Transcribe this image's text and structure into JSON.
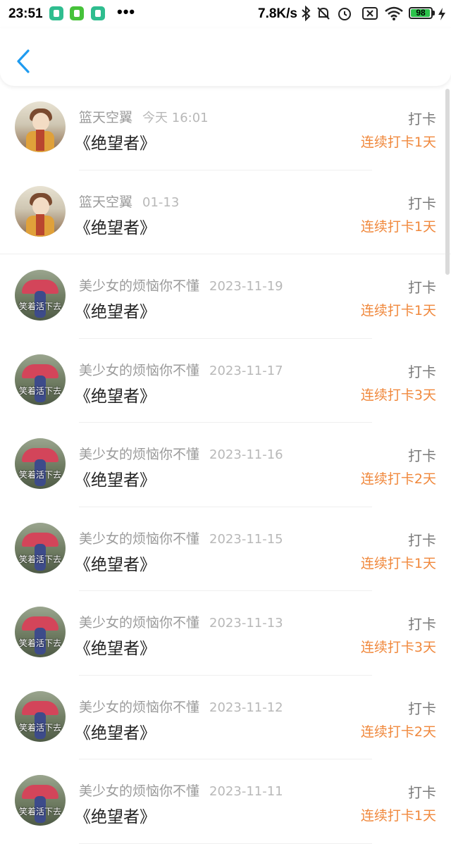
{
  "status_bar": {
    "time": "23:51",
    "dots": "•••",
    "net_speed": "7.8K/s",
    "battery": "98",
    "icons": [
      "bluetooth-icon",
      "mute-icon",
      "alarm-icon",
      "sim-off-icon",
      "wifi-icon",
      "battery-icon",
      "charging-icon"
    ]
  },
  "header": {
    "back_icon": "chevron-left-icon",
    "accent": "#1e9bf0"
  },
  "colors": {
    "streak": "#f0883c",
    "name": "#9a9a9a",
    "date": "#b8b8b8",
    "title": "#222222"
  },
  "items": [
    {
      "name": "篮天空翼",
      "date": "今天 16:01",
      "title": "《绝望者》",
      "punch": "打卡",
      "streak": "连续打卡1天",
      "avatar": "anime"
    },
    {
      "name": "篮天空翼",
      "date": "01-13",
      "title": "《绝望者》",
      "punch": "打卡",
      "streak": "连续打卡1天",
      "avatar": "anime"
    },
    {
      "name": "美少女的烦恼你不懂",
      "date": "2023-11-19",
      "title": "《绝望者》",
      "punch": "打卡",
      "streak": "连续打卡1天",
      "avatar": "photo",
      "avatar_text": "笑着活下去"
    },
    {
      "name": "美少女的烦恼你不懂",
      "date": "2023-11-17",
      "title": "《绝望者》",
      "punch": "打卡",
      "streak": "连续打卡3天",
      "avatar": "photo",
      "avatar_text": "笑着活下去"
    },
    {
      "name": "美少女的烦恼你不懂",
      "date": "2023-11-16",
      "title": "《绝望者》",
      "punch": "打卡",
      "streak": "连续打卡2天",
      "avatar": "photo",
      "avatar_text": "笑着活下去"
    },
    {
      "name": "美少女的烦恼你不懂",
      "date": "2023-11-15",
      "title": "《绝望者》",
      "punch": "打卡",
      "streak": "连续打卡1天",
      "avatar": "photo",
      "avatar_text": "笑着活下去"
    },
    {
      "name": "美少女的烦恼你不懂",
      "date": "2023-11-13",
      "title": "《绝望者》",
      "punch": "打卡",
      "streak": "连续打卡3天",
      "avatar": "photo",
      "avatar_text": "笑着活下去"
    },
    {
      "name": "美少女的烦恼你不懂",
      "date": "2023-11-12",
      "title": "《绝望者》",
      "punch": "打卡",
      "streak": "连续打卡2天",
      "avatar": "photo",
      "avatar_text": "笑着活下去"
    },
    {
      "name": "美少女的烦恼你不懂",
      "date": "2023-11-11",
      "title": "《绝望者》",
      "punch": "打卡",
      "streak": "连续打卡1天",
      "avatar": "photo",
      "avatar_text": "笑着活下去"
    }
  ]
}
